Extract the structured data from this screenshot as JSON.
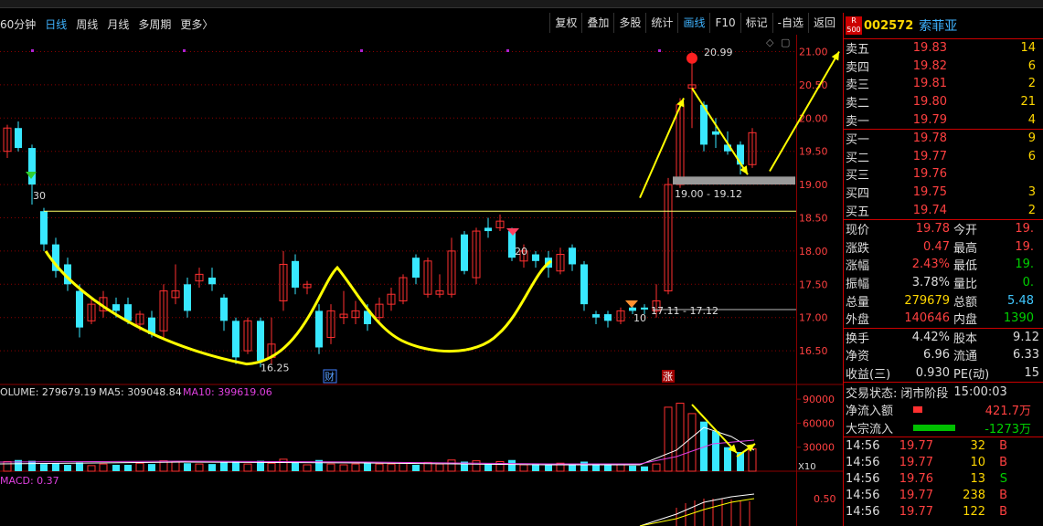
{
  "period_tabs": [
    "60分钟",
    "日线",
    "周线",
    "月线",
    "多周期",
    "更多〉"
  ],
  "active_period": "日线",
  "toolbar": [
    "复权",
    "叠加",
    "多股",
    "统计",
    "画线",
    "F10",
    "标记",
    "-自选",
    "返回"
  ],
  "active_tool": "画线",
  "stock": {
    "badge_top": "R",
    "badge_bottom": "500",
    "code": "002572",
    "name": "索菲亚"
  },
  "chart_labels": {
    "price_axis": [
      "21.00",
      "20.50",
      "20.00",
      "19.50",
      "19.00",
      "18.50",
      "18.00",
      "17.50",
      "17.00",
      "16.50"
    ],
    "high_mark": "20.99",
    "low_mark": "16.25",
    "zone_upper": "19.00 - 19.12",
    "zone_lower": "17.11 - 17.12",
    "marker_30": "30",
    "marker_20": "20",
    "marker_10": "10",
    "event_cai": "财",
    "event_zhang": "涨",
    "volume_title": "OLUME: 279679.19",
    "ma5": "MA5: 309048.84",
    "ma10": "MA10: 399619.06",
    "vol_axis": [
      "90000",
      "60000",
      "30000"
    ],
    "vol_unit": "X10",
    "macd_title": "MACD: 0.37",
    "macd_axis": [
      "0.50"
    ]
  },
  "order_book": {
    "sell": [
      {
        "label": "卖五",
        "price": "19.83",
        "vol": "14"
      },
      {
        "label": "卖四",
        "price": "19.82",
        "vol": "6"
      },
      {
        "label": "卖三",
        "price": "19.81",
        "vol": "2"
      },
      {
        "label": "卖二",
        "price": "19.80",
        "vol": "21"
      },
      {
        "label": "卖一",
        "price": "19.79",
        "vol": "4"
      }
    ],
    "buy": [
      {
        "label": "买一",
        "price": "19.78",
        "vol": "9"
      },
      {
        "label": "买二",
        "price": "19.77",
        "vol": "6"
      },
      {
        "label": "买三",
        "price": "19.76",
        "vol": ""
      },
      {
        "label": "买四",
        "price": "19.75",
        "vol": "3"
      },
      {
        "label": "买五",
        "price": "19.74",
        "vol": "2"
      }
    ]
  },
  "quote": [
    {
      "l1": "现价",
      "v1": "19.78",
      "c1": "red",
      "l2": "今开",
      "v2": "19.",
      "c2": "red"
    },
    {
      "l1": "涨跌",
      "v1": "0.47",
      "c1": "red",
      "l2": "最高",
      "v2": "19.",
      "c2": "red"
    },
    {
      "l1": "涨幅",
      "v1": "2.43%",
      "c1": "red",
      "l2": "最低",
      "v2": "19.",
      "c2": "grn"
    },
    {
      "l1": "振幅",
      "v1": "3.78%",
      "c1": "plain",
      "l2": "量比",
      "v2": "0.",
      "c2": "grn"
    },
    {
      "l1": "总量",
      "v1": "279679",
      "c1": "yel",
      "l2": "总额",
      "v2": "5.48",
      "c2": "cyan"
    },
    {
      "l1": "外盘",
      "v1": "140646",
      "c1": "red",
      "l2": "内盘",
      "v2": "1390",
      "c2": "grn"
    }
  ],
  "fundamentals": [
    {
      "l1": "换手",
      "v1": "4.42%",
      "l2": "股本",
      "v2": "9.12"
    },
    {
      "l1": "净资",
      "v1": "6.96",
      "l2": "流通",
      "v2": "6.33"
    },
    {
      "l1": "收益(三)",
      "v1": "0.930",
      "l2": "PE(动)",
      "v2": "15"
    }
  ],
  "trade_status": {
    "label": "交易状态:",
    "value": "闭市阶段",
    "time": "15:00:03"
  },
  "flows": [
    {
      "label": "净流入额",
      "value": "421.7万",
      "color": "red",
      "bar": 10
    },
    {
      "label": "大宗流入",
      "value": "-1273万",
      "color": "grn",
      "bar": 46
    }
  ],
  "ticks": [
    {
      "time": "14:56",
      "price": "19.77",
      "vol": "32",
      "flag": "B"
    },
    {
      "time": "14:56",
      "price": "19.77",
      "vol": "10",
      "flag": "B"
    },
    {
      "time": "14:56",
      "price": "19.76",
      "vol": "13",
      "flag": "S"
    },
    {
      "time": "14:56",
      "price": "19.77",
      "vol": "238",
      "flag": "B"
    },
    {
      "time": "14:56",
      "price": "19.77",
      "vol": "122",
      "flag": "B"
    }
  ],
  "colors": {
    "up": "#ff3030",
    "down": "#38e8ff",
    "trend": "#ffff00",
    "ma5": "#ffffff",
    "ma10": "#e040e0",
    "grid": "#8b0000"
  }
}
